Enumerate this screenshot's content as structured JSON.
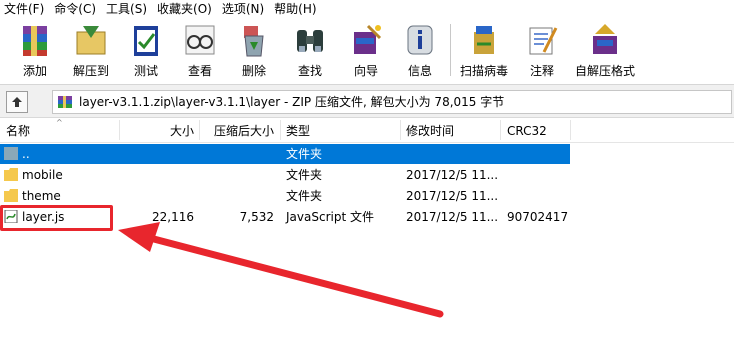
{
  "menu": [
    "文件(F)",
    "命令(C)",
    "工具(S)",
    "收藏夹(O)",
    "选项(N)",
    "帮助(H)"
  ],
  "toolbar": [
    {
      "label": "添加",
      "icon": "books-add-icon"
    },
    {
      "label": "解压到",
      "icon": "extract-folder-icon"
    },
    {
      "label": "测试",
      "icon": "test-clipboard-icon"
    },
    {
      "label": "查看",
      "icon": "view-glasses-icon"
    },
    {
      "label": "删除",
      "icon": "delete-recycle-icon"
    },
    {
      "label": "查找",
      "icon": "find-binoculars-icon"
    },
    {
      "label": "向导",
      "icon": "wizard-icon"
    },
    {
      "label": "信息",
      "icon": "info-icon"
    },
    {
      "label": "扫描病毒",
      "icon": "scan-virus-icon"
    },
    {
      "label": "注释",
      "icon": "comment-icon"
    },
    {
      "label": "自解压格式",
      "icon": "sfx-icon"
    }
  ],
  "address": {
    "path": "layer-v3.1.1.zip\\layer-v3.1.1\\layer - ZIP 压缩文件, 解包大小为 78,015 字节"
  },
  "columns": [
    "名称",
    "大小",
    "压缩后大小",
    "类型",
    "修改时间",
    "CRC32"
  ],
  "rows": [
    {
      "name": "..",
      "size": "",
      "packed": "",
      "type": "文件夹",
      "modified": "",
      "crc": "",
      "icon": "parent-folder-icon",
      "selected": true
    },
    {
      "name": "mobile",
      "size": "",
      "packed": "",
      "type": "文件夹",
      "modified": "2017/12/5 11...",
      "crc": "",
      "icon": "folder-icon",
      "selected": false
    },
    {
      "name": "theme",
      "size": "",
      "packed": "",
      "type": "文件夹",
      "modified": "2017/12/5 11...",
      "crc": "",
      "icon": "folder-icon",
      "selected": false
    },
    {
      "name": "layer.js",
      "size": "22,116",
      "packed": "7,532",
      "type": "JavaScript 文件",
      "modified": "2017/12/5 11...",
      "crc": "90702417",
      "icon": "js-file-icon",
      "selected": false
    }
  ],
  "colors": {
    "selection": "#0078d7",
    "annotation": "#e8262d",
    "folder": "#f5c84c"
  }
}
